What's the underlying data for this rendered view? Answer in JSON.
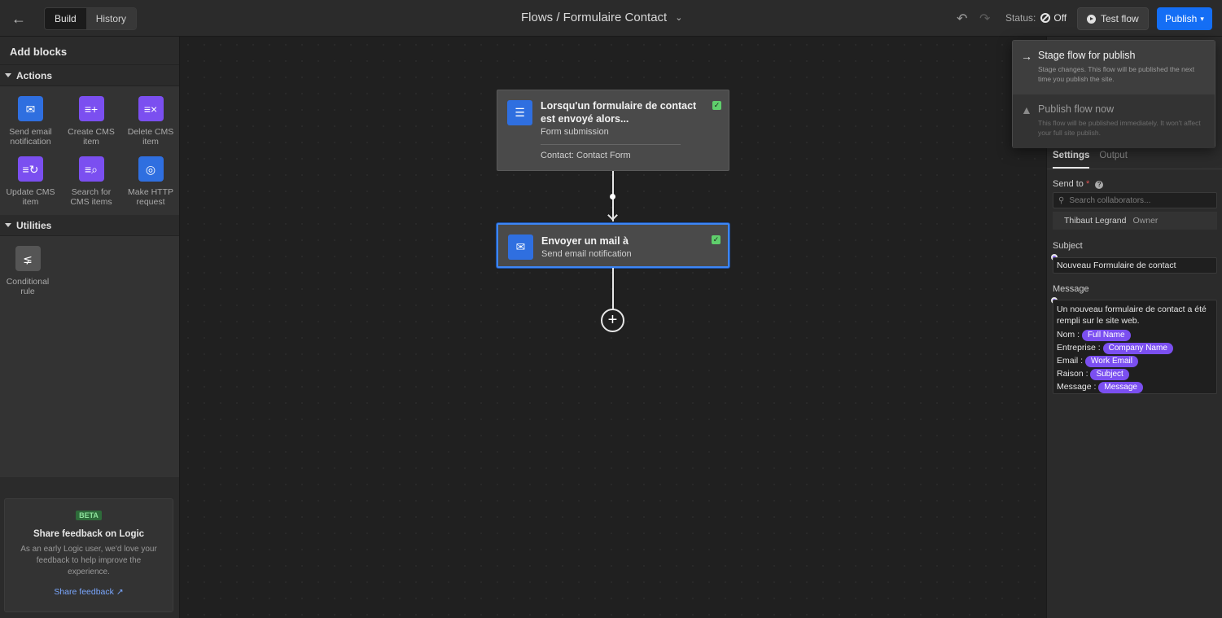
{
  "topbar": {
    "tabs": [
      {
        "label": "Build"
      },
      {
        "label": "History"
      }
    ],
    "title": "Flows / Formulaire Contact",
    "status_label": "Status:",
    "status_value": "Off",
    "test_label": "Test flow",
    "publish_label": "Publish"
  },
  "left": {
    "title": "Add blocks",
    "actions_label": "Actions",
    "actions": [
      {
        "label": "Send email notification",
        "icon": "mail-icon"
      },
      {
        "label": "Create CMS item",
        "icon": "cms-add-icon"
      },
      {
        "label": "Delete CMS item",
        "icon": "cms-delete-icon"
      },
      {
        "label": "Update CMS item",
        "icon": "cms-update-icon"
      },
      {
        "label": "Search for CMS items",
        "icon": "cms-search-icon"
      },
      {
        "label": "Make HTTP request",
        "icon": "globe-icon"
      }
    ],
    "utilities_label": "Utilities",
    "utilities": [
      {
        "label": "Conditional rule",
        "icon": "branch-icon"
      }
    ],
    "feedback": {
      "badge": "BETA",
      "title": "Share feedback on Logic",
      "body": "As an early Logic user, we'd love your feedback to help improve the experience.",
      "link": "Share feedback"
    }
  },
  "canvas": {
    "node1": {
      "title": "Lorsqu'un formulaire de contact est envoyé alors...",
      "subtitle": "Form submission",
      "detail": "Contact: Contact Form"
    },
    "node2": {
      "title": "Envoyer un mail à",
      "subtitle": "Send email notification"
    }
  },
  "dropdown": {
    "items": [
      {
        "title": "Stage flow for publish",
        "desc": "Stage changes. This flow will be published the next time you publish the site."
      },
      {
        "title": "Publish flow now",
        "desc": "This flow will be published immediately. It won't affect your full site publish."
      }
    ]
  },
  "right": {
    "tabs": [
      {
        "label": "Settings"
      },
      {
        "label": "Output"
      }
    ],
    "send_to_label": "Send to",
    "required_mark": "*",
    "search_placeholder": "Search collaborators...",
    "collaborator": {
      "name": "Thibaut Legrand",
      "role": "Owner"
    },
    "subject_label": "Subject",
    "subject_value": "Nouveau Formulaire de contact",
    "message_label": "Message",
    "message_intro": "Un nouveau formulaire de contact a été rempli sur le site web.",
    "message_rows": [
      {
        "label": "Nom :",
        "pill": "Full Name"
      },
      {
        "label": "Entreprise :",
        "pill": "Company Name"
      },
      {
        "label": "Email :",
        "pill": "Work Email"
      },
      {
        "label": "Raison :",
        "pill": "Subject"
      },
      {
        "label": "Message :",
        "pill": "Message"
      }
    ]
  },
  "colors": {
    "accent": "#146ef5",
    "purple": "#7b4ff0",
    "node_border": "#3d86f5"
  }
}
